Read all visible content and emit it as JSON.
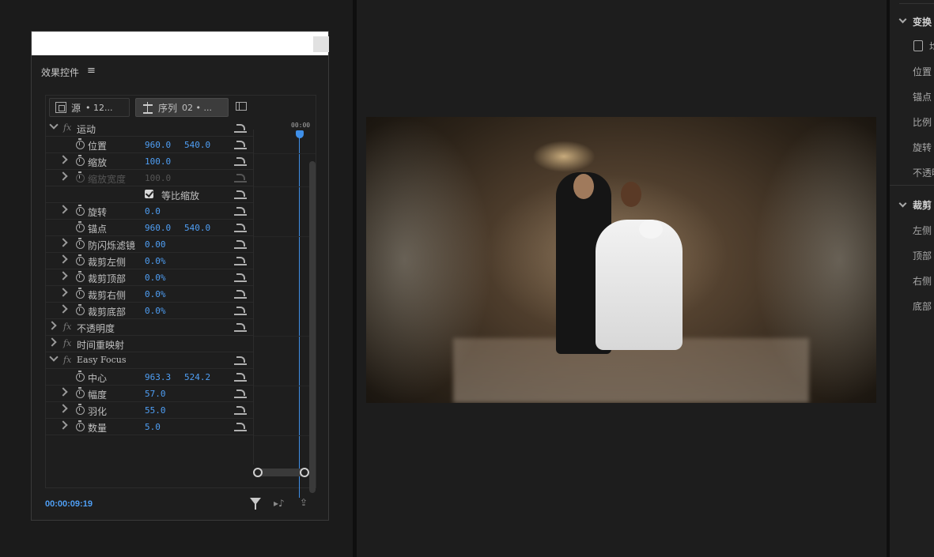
{
  "effect_controls": {
    "title": "效果控件",
    "menu_icon": "≡",
    "source_tab": {
      "prefix": "源",
      "label": "• 12..."
    },
    "sequence_tab": {
      "prefix": "序列",
      "label": "02 • ..."
    },
    "ruler_time": "00:00",
    "timecode": "00:00:09:19",
    "sections": {
      "motion": "运动",
      "opacity": "不透明度",
      "time_remap": "时间重映射",
      "easy_focus": "Easy Focus"
    },
    "props": {
      "position": {
        "label": "位置",
        "v1": "960.0",
        "v2": "540.0"
      },
      "scale": {
        "label": "缩放",
        "v1": "100.0"
      },
      "scale_width": {
        "label": "缩放宽度",
        "v1": "100.0"
      },
      "uniform_scale": {
        "label": "等比缩放"
      },
      "rotation": {
        "label": "旋转",
        "v1": "0.0"
      },
      "anchor": {
        "label": "锚点",
        "v1": "960.0",
        "v2": "540.0"
      },
      "flicker": {
        "label": "防闪烁滤镜",
        "v1": "0.00"
      },
      "crop_left": {
        "label": "裁剪左侧",
        "v1": "0.0%"
      },
      "crop_top": {
        "label": "裁剪顶部",
        "v1": "0.0%"
      },
      "crop_right": {
        "label": "裁剪右侧",
        "v1": "0.0%"
      },
      "crop_bottom": {
        "label": "裁剪底部",
        "v1": "0.0%"
      },
      "center": {
        "label": "中心",
        "v1": "963.3",
        "v2": "524.2"
      },
      "amount": {
        "label": "幅度",
        "v1": "57.0"
      },
      "feather": {
        "label": "羽化",
        "v1": "55.0"
      },
      "count": {
        "label": "数量",
        "v1": "5.0"
      }
    }
  },
  "right_panel": {
    "transform_head": "变换",
    "box_label": "均",
    "items": [
      "位置",
      "锚点",
      "比例",
      "旋转",
      "不透明"
    ],
    "crop_head": "裁剪",
    "crop_items": [
      "左侧",
      "顶部",
      "右侧",
      "底部"
    ]
  },
  "accent_color": "#4f9ff5",
  "icons": [
    "menu-icon",
    "chevron-right-icon",
    "chevron-down-icon",
    "fx-icon",
    "stopwatch-icon",
    "reset-icon",
    "checkbox-icon",
    "filter-icon",
    "audio-icon",
    "export-icon",
    "panel-toggle-icon"
  ]
}
